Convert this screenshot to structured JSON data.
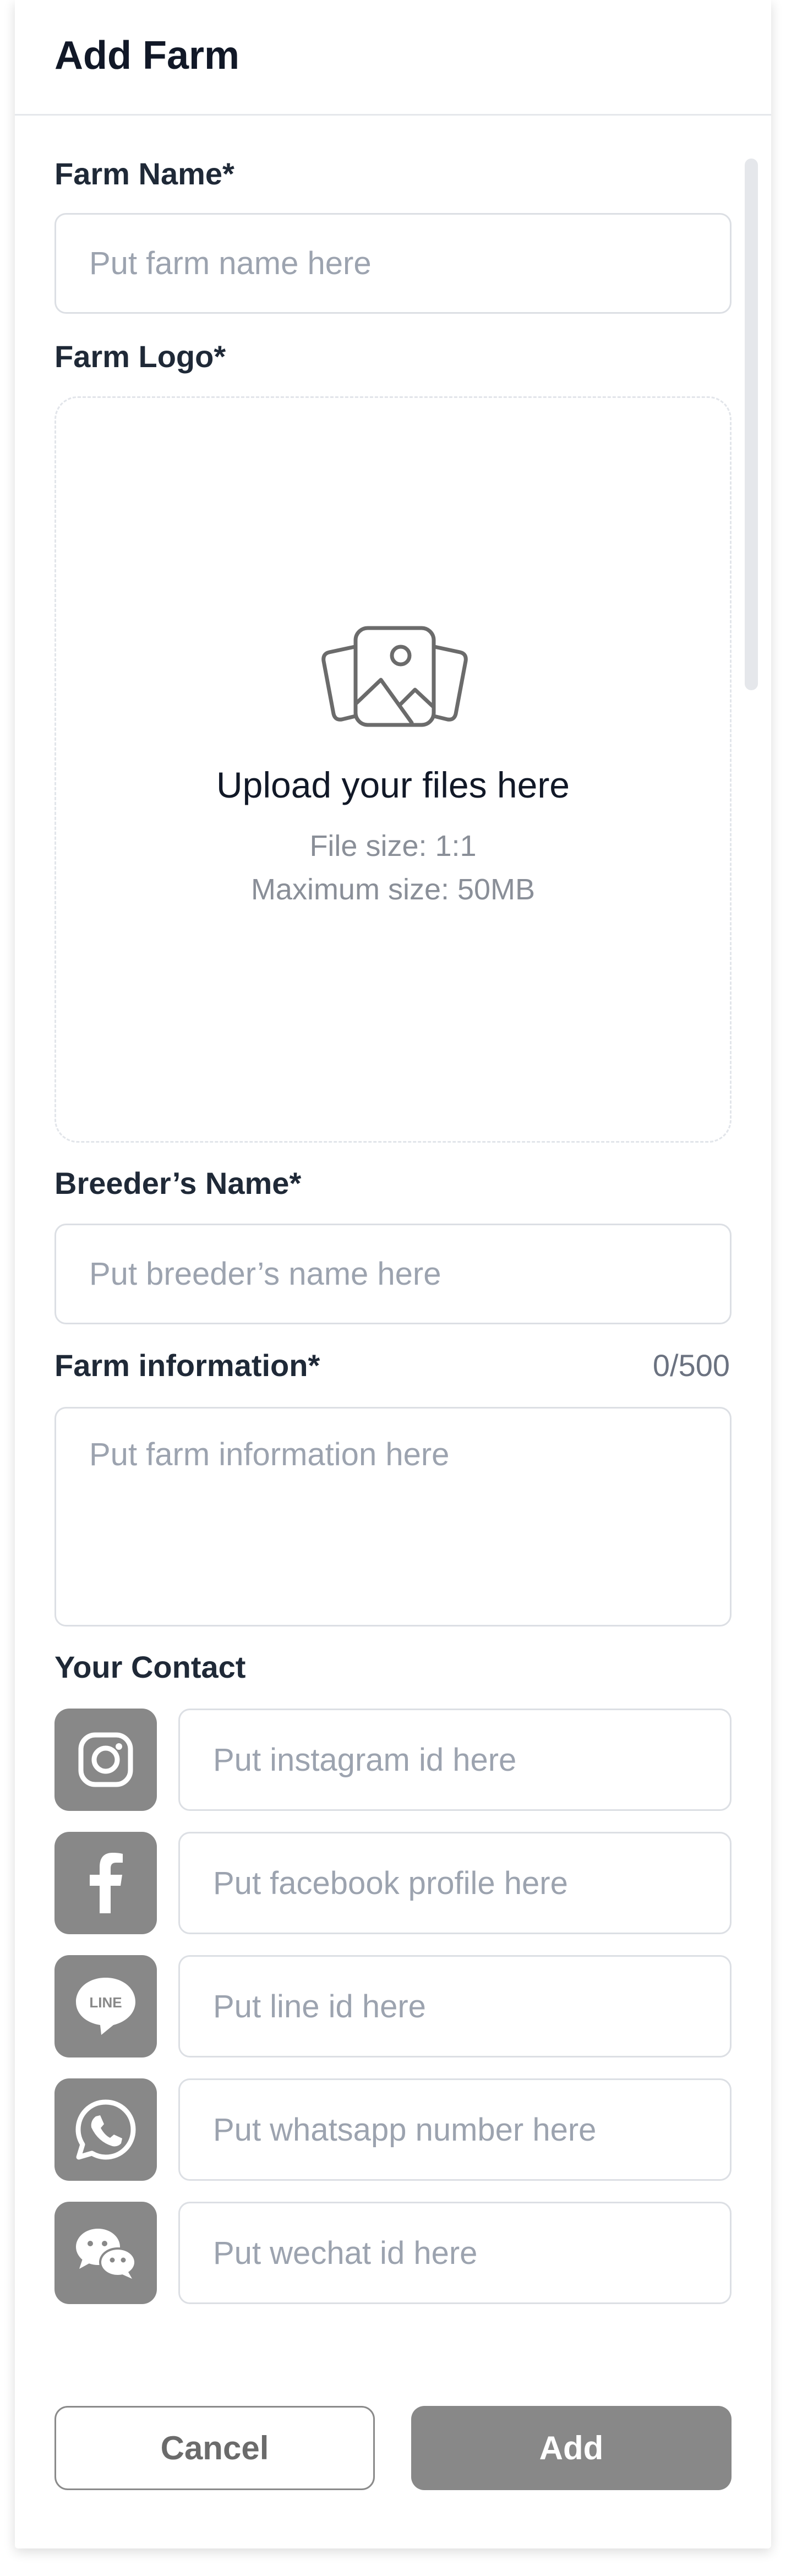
{
  "header": {
    "title": "Add Farm"
  },
  "farm_name": {
    "label": "Farm Name*",
    "placeholder": "Put farm name here",
    "value": ""
  },
  "farm_logo": {
    "label": "Farm Logo*",
    "upload_title": "Upload your files here",
    "file_size": "File size: 1:1",
    "max_size": "Maximum size: 50MB",
    "icon": "image-upload-icon"
  },
  "breeder_name": {
    "label": "Breeder’s Name*",
    "placeholder": "Put breeder’s name here",
    "value": ""
  },
  "farm_info": {
    "label": "Farm information*",
    "counter": "0/500",
    "placeholder": "Put farm information here",
    "value": ""
  },
  "contact": {
    "label": "Your Contact",
    "items": [
      {
        "icon": "instagram-icon",
        "placeholder": "Put instagram id here"
      },
      {
        "icon": "facebook-icon",
        "placeholder": "Put facebook profile here"
      },
      {
        "icon": "line-icon",
        "placeholder": "Put line id here",
        "icon_text": "LINE"
      },
      {
        "icon": "whatsapp-icon",
        "placeholder": "Put whatsapp number here"
      },
      {
        "icon": "wechat-icon",
        "placeholder": "Put wechat id here"
      }
    ]
  },
  "actions": {
    "cancel_label": "Cancel",
    "add_label": "Add"
  },
  "colors": {
    "icon_bg": "#888888",
    "primary_button": "#888888",
    "border": "#dcdfe4",
    "placeholder": "#9ca3af"
  }
}
